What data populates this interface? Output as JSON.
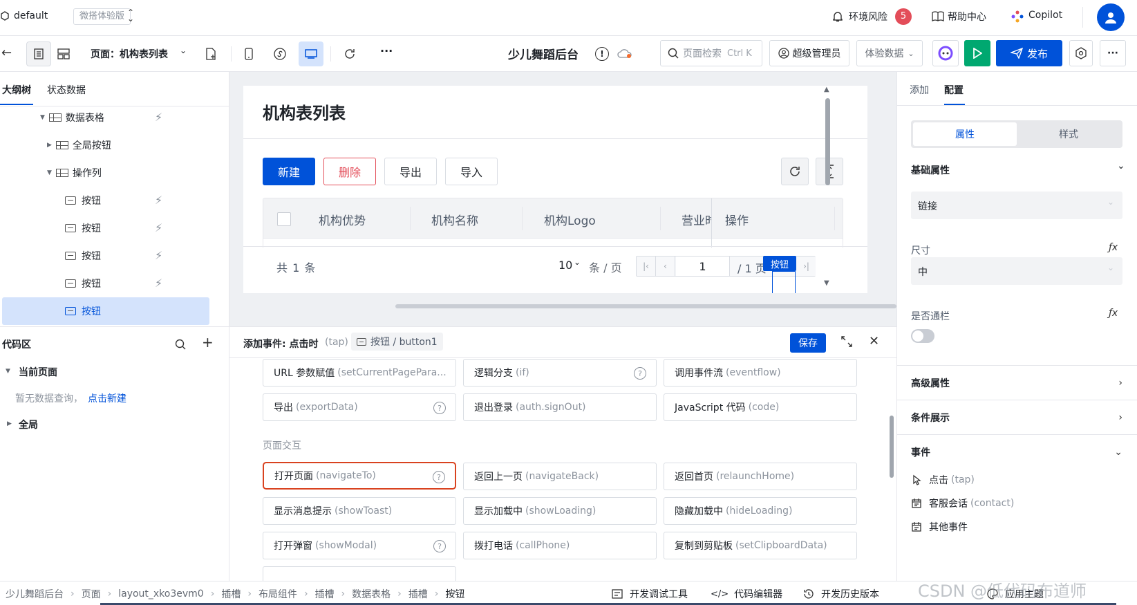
{
  "topbar": {
    "env_name": "default",
    "edition_badge": "微搭体验版",
    "env_risk_label": "环境风险",
    "env_risk_count": "5",
    "help_label": "帮助中心",
    "copilot_label": "Copilot"
  },
  "toolbar": {
    "page_label": "页面：机构表列表",
    "app_title": "少儿舞蹈后台",
    "search_placeholder": "页面检索",
    "search_shortcut": "Ctrl K",
    "role_label": "超级管理员",
    "data_mode_label": "体验数据",
    "publish_label": "发布",
    "more_label": "···"
  },
  "left": {
    "tab_outline": "大纲树",
    "tab_state": "状态数据",
    "tree": [
      {
        "label": "数据表格"
      },
      {
        "label": "全局按钮"
      },
      {
        "label": "操作列"
      },
      {
        "label": "按钮"
      },
      {
        "label": "按钮"
      },
      {
        "label": "按钮"
      },
      {
        "label": "按钮"
      },
      {
        "label": "按钮"
      }
    ],
    "code_area_title": "代码区",
    "current_page": "当前页面",
    "empty_text": "暂无数据查询，",
    "new_link": "点击新建",
    "global": "全局"
  },
  "canvas": {
    "page_heading": "机构表列表",
    "buttons": [
      "新建",
      "删除",
      "导出",
      "导入"
    ],
    "columns": [
      "机构优势",
      "机构名称",
      "机构Logo",
      "营业时",
      "操作"
    ],
    "total_text": "共 1 条",
    "page_size": "10",
    "per_page": "条 / 页",
    "current_page": "1",
    "total_pages": "/ 1 页",
    "selected_tag": "按钮"
  },
  "event_panel": {
    "title_prefix": "添加事件: 点击时",
    "title_en": "(tap)",
    "target_chip": "按钮 / button1",
    "save_label": "保存",
    "group_page_interaction": "页面交互",
    "actions": [
      {
        "cn": "URL 参数赋值",
        "en": "(setCurrentPagePara..."
      },
      {
        "cn": "逻辑分支",
        "en": "(if)",
        "help": "?"
      },
      {
        "cn": "调用事件流",
        "en": "(eventflow)"
      },
      {
        "cn": "导出",
        "en": "(exportData)",
        "help": "?"
      },
      {
        "cn": "退出登录",
        "en": "(auth.signOut)"
      },
      {
        "cn": "JavaScript 代码",
        "en": "(code)"
      },
      {
        "cn": "打开页面",
        "en": "(navigateTo)",
        "help": "?"
      },
      {
        "cn": "返回上一页",
        "en": "(navigateBack)"
      },
      {
        "cn": "返回首页",
        "en": "(relaunchHome)"
      },
      {
        "cn": "显示消息提示",
        "en": "(showToast)"
      },
      {
        "cn": "显示加载中",
        "en": "(showLoading)"
      },
      {
        "cn": "隐藏加载中",
        "en": "(hideLoading)"
      },
      {
        "cn": "打开弹窗",
        "en": "(showModal)",
        "help": "?"
      },
      {
        "cn": "拨打电话",
        "en": "(callPhone)"
      },
      {
        "cn": "复制到剪贴板",
        "en": "(setClipboardData)"
      }
    ]
  },
  "right": {
    "tab_add": "添加",
    "tab_config": "配置",
    "seg_props": "属性",
    "seg_style": "样式",
    "basic_props": "基础属性",
    "type_value": "链接",
    "size_label": "尺寸",
    "size_value": "中",
    "block_label": "是否通栏",
    "fx": "ƒx",
    "advanced": "高级属性",
    "conditional": "条件展示",
    "events": "事件",
    "event_items": [
      {
        "cn": "点击",
        "en": "(tap)"
      },
      {
        "cn": "客服会话",
        "en": "(contact)"
      },
      {
        "cn": "其他事件",
        "en": ""
      }
    ]
  },
  "bottom": {
    "crumbs": [
      "少儿舞蹈后台",
      "页面",
      "layout_xko3evm0",
      "插槽",
      "布局组件",
      "插槽",
      "数据表格",
      "插槽",
      "按钮"
    ],
    "dev_tools": "开发调试工具",
    "code_editor": "代码编辑器",
    "history": "开发历史版本",
    "theme": "应用主题",
    "watermark": "CSDN @低代码布道师"
  },
  "colors": {
    "primary": "#0052d9",
    "danger": "#e34d59",
    "green": "#00a870",
    "selected_bg": "#d4e3fc"
  }
}
